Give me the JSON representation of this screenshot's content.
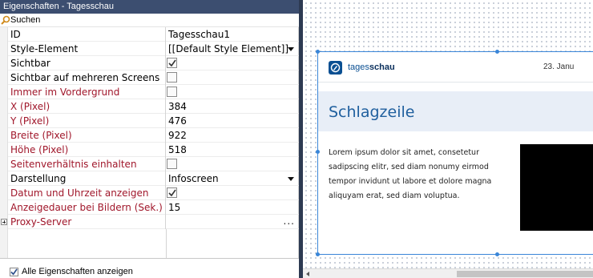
{
  "panel": {
    "title": "Eigenschaften - Tagesschau",
    "search_placeholder": "Suchen",
    "rows": [
      {
        "name": "ID",
        "value": "Tagesschau1",
        "kind": "text",
        "red": false
      },
      {
        "name": "Style-Element",
        "value": "[[Default Style Element]]",
        "kind": "dropdown",
        "red": false
      },
      {
        "name": "Sichtbar",
        "value": "",
        "kind": "checkbox",
        "checked": true,
        "red": false
      },
      {
        "name": "Sichtbar auf mehreren Screens",
        "value": "",
        "kind": "checkbox",
        "checked": false,
        "red": false
      },
      {
        "name": "Immer im Vordergrund",
        "value": "",
        "kind": "checkbox",
        "checked": false,
        "red": true
      },
      {
        "name": "X (Pixel)",
        "value": "384",
        "kind": "text",
        "red": true
      },
      {
        "name": "Y (Pixel)",
        "value": "476",
        "kind": "text",
        "red": true
      },
      {
        "name": "Breite (Pixel)",
        "value": "922",
        "kind": "text",
        "red": true
      },
      {
        "name": "Höhe (Pixel)",
        "value": "518",
        "kind": "text",
        "red": true
      },
      {
        "name": "Seitenverhältnis einhalten",
        "value": "",
        "kind": "checkbox",
        "checked": false,
        "red": true
      },
      {
        "name": "Darstellung",
        "value": "Infoscreen",
        "kind": "dropdown",
        "red": false
      },
      {
        "name": "Datum und Uhrzeit anzeigen",
        "value": "",
        "kind": "checkbox",
        "checked": true,
        "red": true
      },
      {
        "name": "Anzeigedauer bei Bildern (Sek.)",
        "value": "15",
        "kind": "text",
        "red": true
      },
      {
        "name": "Proxy-Server",
        "value": "...",
        "kind": "expandable",
        "red": true
      }
    ],
    "footer_label": "Alle Eigenschaften anzeigen",
    "footer_checked": true
  },
  "widget": {
    "brand_prefix": "tages",
    "brand_bold": "schau",
    "date": "23. Janu",
    "headline": "Schlagzeile",
    "body": "Lorem ipsum dolor sit amet, consetetur sadipscing elitr, sed diam nonumy eirmod tempor invidunt ut labore et dolore magna aliquyam erat, sed diam voluptua."
  },
  "colors": {
    "titlebar": "#3c4e70",
    "splitter": "#2d3a52",
    "property_red": "#a0162a",
    "selection_blue": "#3a86d8",
    "brand_blue": "#0a4f92",
    "headline_blue": "#1f5f9e"
  },
  "icons": {
    "search": "magnifier-icon",
    "checkbox_checked": "checkmark-icon",
    "dropdown": "chevron-down-icon",
    "expand": "plus-box-icon",
    "logo": "tagesschau-logo-icon"
  }
}
